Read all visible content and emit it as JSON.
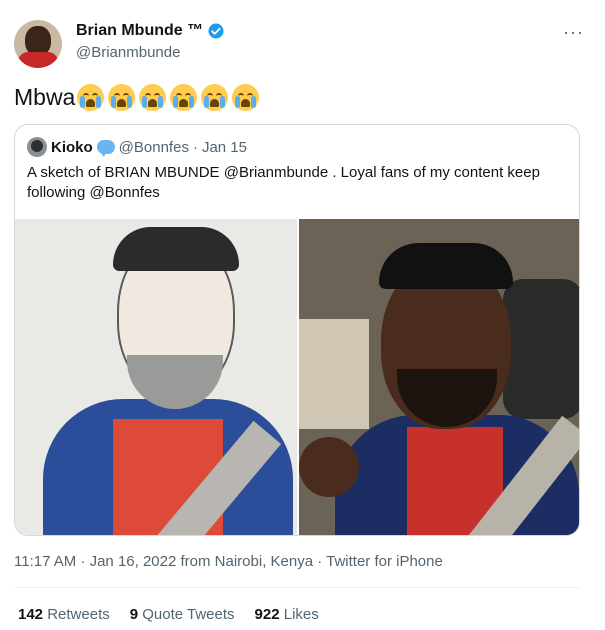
{
  "author": {
    "display_name": "Brian Mbunde ™",
    "handle": "@Brianmbunde",
    "avatar_icon": "profile-photo",
    "verified_color": "#1d9bf0"
  },
  "more_label": "···",
  "tweet": {
    "text": "Mbwa",
    "emoji_name": "loudly-crying-face",
    "emoji_count": 6
  },
  "quoted": {
    "display_name": "Kioko",
    "handle": "@Bonnfes",
    "separator": "·",
    "date": "Jan 15",
    "text": "A sketch of BRIAN MBUNDE @Brianmbunde . Loyal fans of my content keep following @Bonnfes"
  },
  "timestamp": "11:17 AM · Jan 16, 2022 from Nairobi, Kenya · Twitter for iPhone",
  "stats": [
    {
      "count": "142",
      "label": "Retweets"
    },
    {
      "count": "9",
      "label": "Quote Tweets"
    },
    {
      "count": "922",
      "label": "Likes"
    }
  ]
}
